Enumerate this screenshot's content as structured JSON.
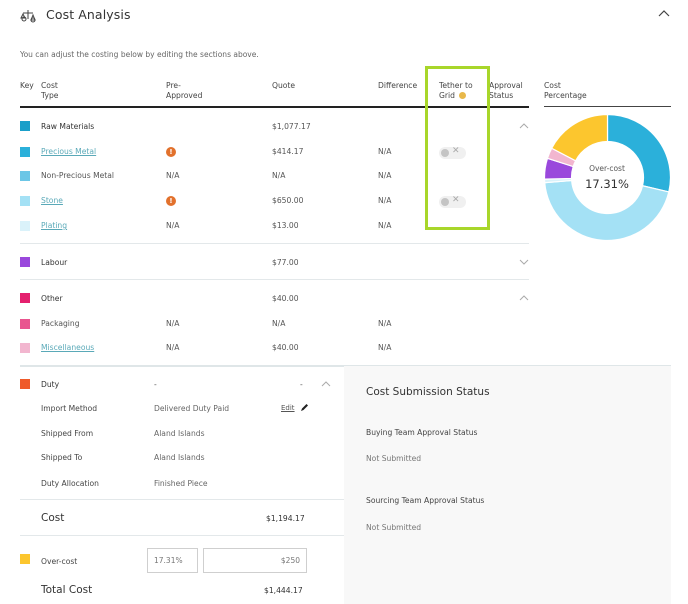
{
  "header": {
    "title": "Cost Analysis",
    "icon": "scales-icon",
    "collapse_icon": "chevron-up-icon"
  },
  "intro_text": "You can adjust the costing below by editing the sections above.",
  "columns": {
    "key": "Key",
    "cost_type_1": "Cost",
    "cost_type_2": "Type",
    "pre_approved_1": "Pre-",
    "pre_approved_2": "Approved",
    "quote": "Quote",
    "difference": "Difference",
    "tether_1": "Tether to",
    "tether_2": "Grid",
    "approval_1": "Approval",
    "approval_2": "Status",
    "cost_pct_1": "Cost",
    "cost_pct_2": "Percentage"
  },
  "colors": {
    "raw_materials": "#1a9fc9",
    "precious_metal": "#2bb0da",
    "non_precious_metal": "#6cc6e6",
    "stone": "#a4e1f5",
    "plating": "#daf2fa",
    "labour": "#9a48dc",
    "other": "#e4206e",
    "packaging": "#e9558f",
    "miscellaneous": "#f2b6cf",
    "duty": "#ef5a2a",
    "over_cost": "#fcc62e",
    "tether_highlight": "#a8d62a",
    "warning": "#e2712c",
    "info_dot": "#e8b84a"
  },
  "rows": {
    "raw_materials": {
      "label": "Raw Materials",
      "quote": "$1,077.17",
      "expanded": true
    },
    "precious_metal": {
      "label": "Precious Metal",
      "pre_approved": "warning",
      "quote": "$414.17",
      "difference": "N/A",
      "tether": "off"
    },
    "non_precious_metal": {
      "label": "Non-Precious Metal",
      "pre_approved": "N/A",
      "quote": "N/A",
      "difference": "N/A"
    },
    "stone": {
      "label": "Stone",
      "pre_approved": "warning",
      "quote": "$650.00",
      "difference": "N/A",
      "tether": "off"
    },
    "plating": {
      "label": "Plating",
      "pre_approved": "N/A",
      "quote": "$13.00",
      "difference": "N/A"
    },
    "labour": {
      "label": "Labour",
      "quote": "$77.00",
      "expanded": false
    },
    "other": {
      "label": "Other",
      "quote": "$40.00",
      "expanded": true
    },
    "packaging": {
      "label": "Packaging",
      "pre_approved": "N/A",
      "quote": "N/A",
      "difference": "N/A"
    },
    "miscellaneous": {
      "label": "Miscellaneous",
      "pre_approved": "N/A",
      "quote": "$40.00",
      "difference": "N/A"
    }
  },
  "duty": {
    "label": "Duty",
    "value": "-",
    "value2": "-",
    "fields": [
      {
        "label": "Import Method",
        "value": "Delivered Duty Paid"
      },
      {
        "label": "Shipped From",
        "value": "Aland Islands"
      },
      {
        "label": "Shipped To",
        "value": "Aland Islands"
      },
      {
        "label": "Duty Allocation",
        "value": "Finished Piece"
      }
    ],
    "edit_label": "Edit"
  },
  "totals": {
    "cost_label": "Cost",
    "cost_value": "$1,194.17",
    "over_cost_label": "Over-cost",
    "over_cost_percent": "17.31%",
    "over_cost_amount": "$250",
    "total_label": "Total Cost",
    "total_value": "$1,444.17"
  },
  "submission": {
    "title": "Cost Submission Status",
    "buying_label": "Buying Team Approval Status",
    "buying_value": "Not Submitted",
    "sourcing_label": "Sourcing Team Approval Status",
    "sourcing_value": "Not Submitted"
  },
  "donut": {
    "center_label": "Over-cost",
    "center_value": "17.31%",
    "slices": [
      {
        "name": "Precious Metal",
        "value": 414.17,
        "color": "#2bb0da"
      },
      {
        "name": "Stone",
        "value": 650.0,
        "color": "#a4e1f5"
      },
      {
        "name": "Plating",
        "value": 13.0,
        "color": "#daf2fa"
      },
      {
        "name": "Labour",
        "value": 77.0,
        "color": "#9a48dc"
      },
      {
        "name": "Miscellaneous",
        "value": 40.0,
        "color": "#f2b6cf"
      },
      {
        "name": "Over-cost",
        "value": 250,
        "color": "#fcc62e"
      }
    ]
  }
}
